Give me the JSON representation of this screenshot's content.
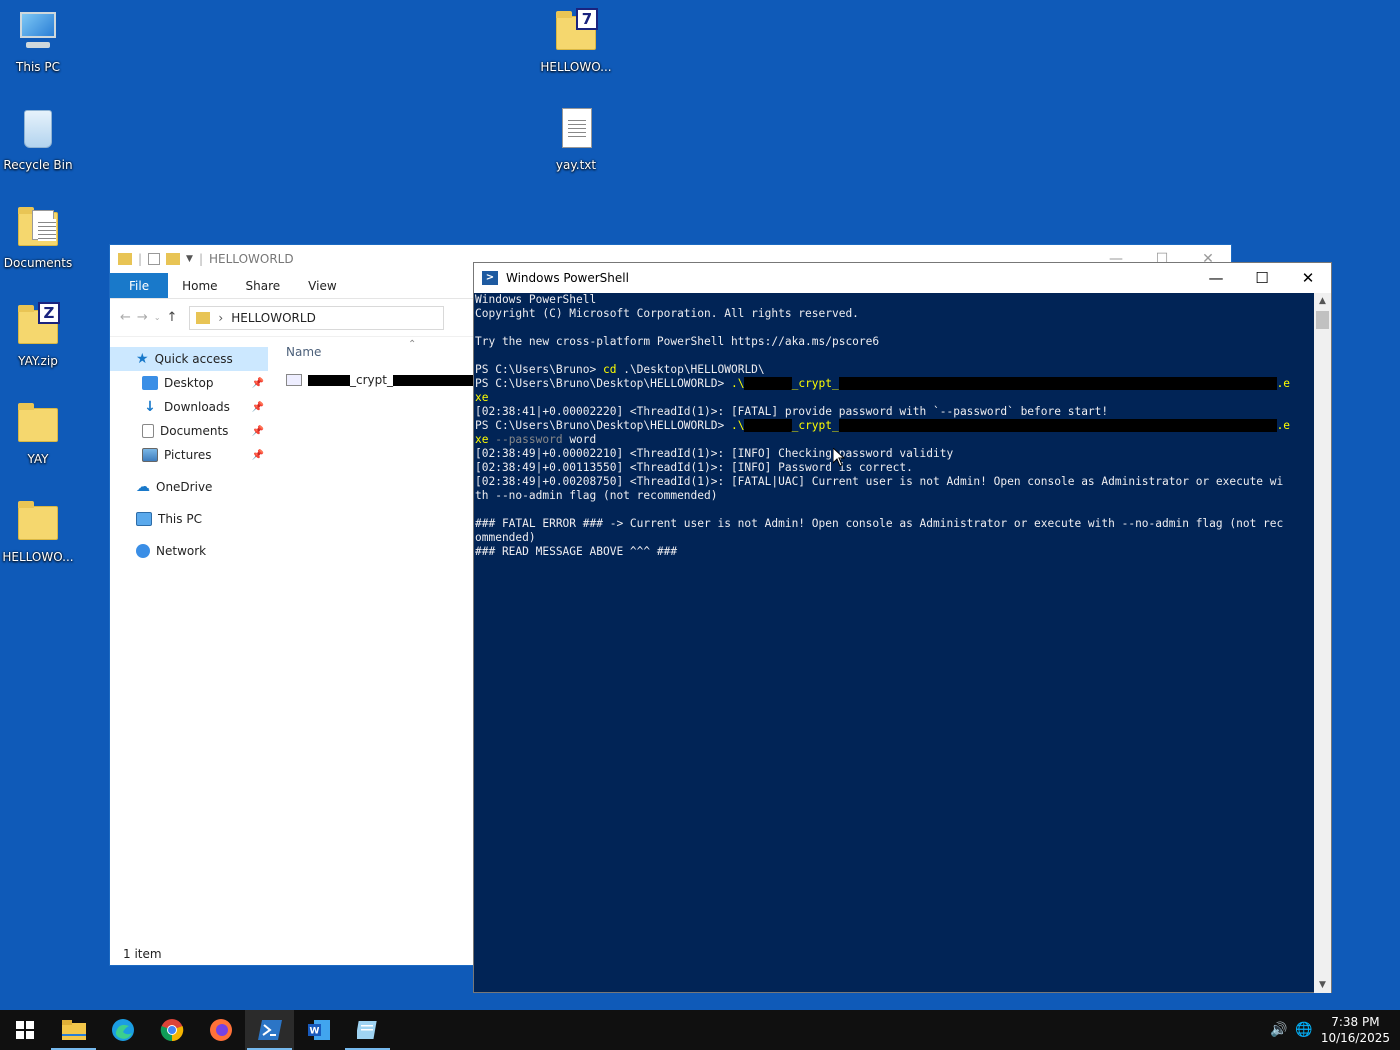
{
  "desktop": {
    "icons": [
      {
        "label": "This PC",
        "icon": "this-pc-icon"
      },
      {
        "label": "Recycle Bin",
        "icon": "recycle-bin-icon"
      },
      {
        "label": "Documents",
        "icon": "documents-shortcut-icon"
      },
      {
        "label": "YAY.zip",
        "icon": "zip-icon"
      },
      {
        "label": "YAY",
        "icon": "folder-icon"
      },
      {
        "label": "HELLOWO...",
        "icon": "folder-icon"
      },
      {
        "label": "HELLOWO...",
        "icon": "7zip-archive-icon"
      },
      {
        "label": "yay.txt",
        "icon": "text-file-icon"
      }
    ]
  },
  "explorer": {
    "title": "HELLOWORLD",
    "ribbon_tabs": [
      "File",
      "Home",
      "Share",
      "View"
    ],
    "address": "HELLOWORLD",
    "nav": {
      "quick_access": "Quick access",
      "desktop": "Desktop",
      "downloads": "Downloads",
      "documents": "Documents",
      "pictures": "Pictures",
      "onedrive": "OneDrive",
      "this_pc": "This PC",
      "network": "Network"
    },
    "column_name": "Name",
    "file_name_visible": "_crypt_",
    "status": "1 item"
  },
  "powershell": {
    "title": "Windows PowerShell",
    "lines": {
      "l1": "Windows PowerShell",
      "l2": "Copyright (C) Microsoft Corporation. All rights reserved.",
      "l3": "Try the new cross-platform PowerShell https://aka.ms/pscore6",
      "p1_prompt": "PS C:\\Users\\Bruno> ",
      "p1_cmd": "cd",
      "p1_arg": " .\\Desktop\\HELLOWORLD\\",
      "p2_prompt": "PS C:\\Users\\Bruno\\Desktop\\HELLOWORLD> ",
      "p2_cmd_a": ".\\",
      "p2_cmd_b": "_crypt_",
      "p2_cmd_c": ".e",
      "p2_cmd_d": "xe",
      "fatal1": "[02:38:41|+0.00002220] <ThreadId(1)>: [FATAL] provide password with `--password` before start!",
      "p3_prompt": "PS C:\\Users\\Bruno\\Desktop\\HELLOWORLD> ",
      "p3_cmd_d": "xe",
      "p3_flag": " --password",
      "p3_val": " word",
      "info1": "[02:38:49|+0.00002210] <ThreadId(1)>: [INFO] Checking password validity",
      "info2": "[02:38:49|+0.00113550] <ThreadId(1)>: [INFO] Password is correct.",
      "fatal2a": "[02:38:49|+0.00208750] <ThreadId(1)>: [FATAL|UAC] Current user is not Admin! Open console as Administrator or execute wi",
      "fatal2b": "th --no-admin flag (not recommended)",
      "err_a": "### FATAL ERROR ### -> Current user is not Admin! Open console as Administrator or execute with --no-admin flag (not rec",
      "err_b": "ommended)",
      "err_c": "### READ MESSAGE ABOVE ^^^ ###"
    }
  },
  "taskbar": {
    "apps": [
      "start-icon",
      "file-explorer-icon",
      "edge-icon",
      "chrome-icon",
      "firefox-icon",
      "powershell-icon",
      "word-icon",
      "notepad-icon"
    ],
    "time": "7:38 PM",
    "date": "10/16/2025"
  },
  "colors": {
    "desktop_bg": "#0f5ab8",
    "console_bg": "#012456",
    "console_text": "#eeedf0",
    "command_yellow": "#ffff00"
  }
}
